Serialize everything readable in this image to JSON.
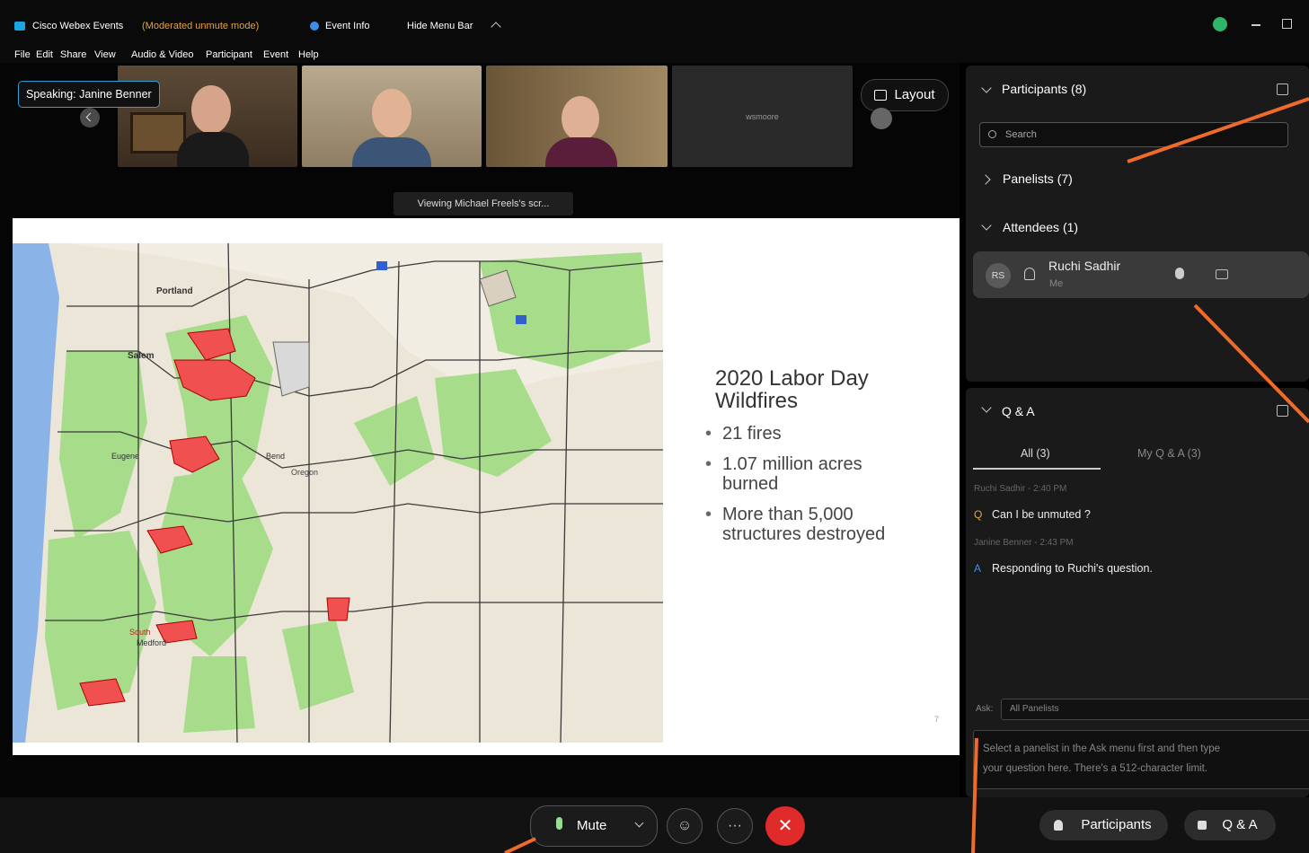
{
  "titlebar": {
    "app_name": "Cisco Webex Events",
    "mode": "(Moderated unmute mode)",
    "event_info": "Event Info",
    "hide_menu": "Hide Menu Bar"
  },
  "menu": [
    "File",
    "Edit",
    "Share",
    "View",
    "Audio & Video",
    "Participant",
    "Event",
    "Help"
  ],
  "stage": {
    "speaking": "Speaking: Janine Benner",
    "layout": "Layout",
    "viewing": "Viewing Michael Freels's scr...",
    "fourth_tile": "wsmoore"
  },
  "slide": {
    "title_line1": "2020 Labor Day",
    "title_line2": "Wildfires",
    "bullets": [
      "21 fires",
      "1.07 million acres",
      "burned",
      "More than 5,000",
      "structures destroyed"
    ],
    "page_number": "7",
    "map_labels": {
      "portland": "Portland",
      "salem": "Salem",
      "eugene": "Eugene",
      "bend": "Bend",
      "medford": "Medford",
      "south": "South",
      "oregon": "Oregon"
    }
  },
  "participants": {
    "header": "Participants (8)",
    "search_placeholder": "Search",
    "panelists": "Panelists (7)",
    "attendees": "Attendees (1)",
    "attendee_initials": "RS",
    "attendee_name": "Ruchi Sadhir",
    "attendee_sub": "Me"
  },
  "qa": {
    "header": "Q & A",
    "tab_all": "All (3)",
    "tab_mine": "My Q & A (3)",
    "q_meta": "Ruchi Sadhir - 2:40 PM",
    "q_text": "Can I be unmuted ?",
    "a_meta": "Janine Benner - 2:43 PM",
    "a_text": "Responding to Ruchi's question.",
    "ask_label": "Ask:",
    "ask_value": "All Panelists",
    "ask_placeholder_line1": "Select a panelist in the Ask menu first and then type",
    "ask_placeholder_line2": "your question here. There's a 512-character limit."
  },
  "bottombar": {
    "mute": "Mute",
    "participants": "Participants",
    "qa": "Q & A"
  },
  "colors": {
    "accent_orange": "#f06a2a",
    "map_green": "#a6dc8a",
    "fire_red": "#f05050",
    "end_red": "#e02b2b"
  }
}
